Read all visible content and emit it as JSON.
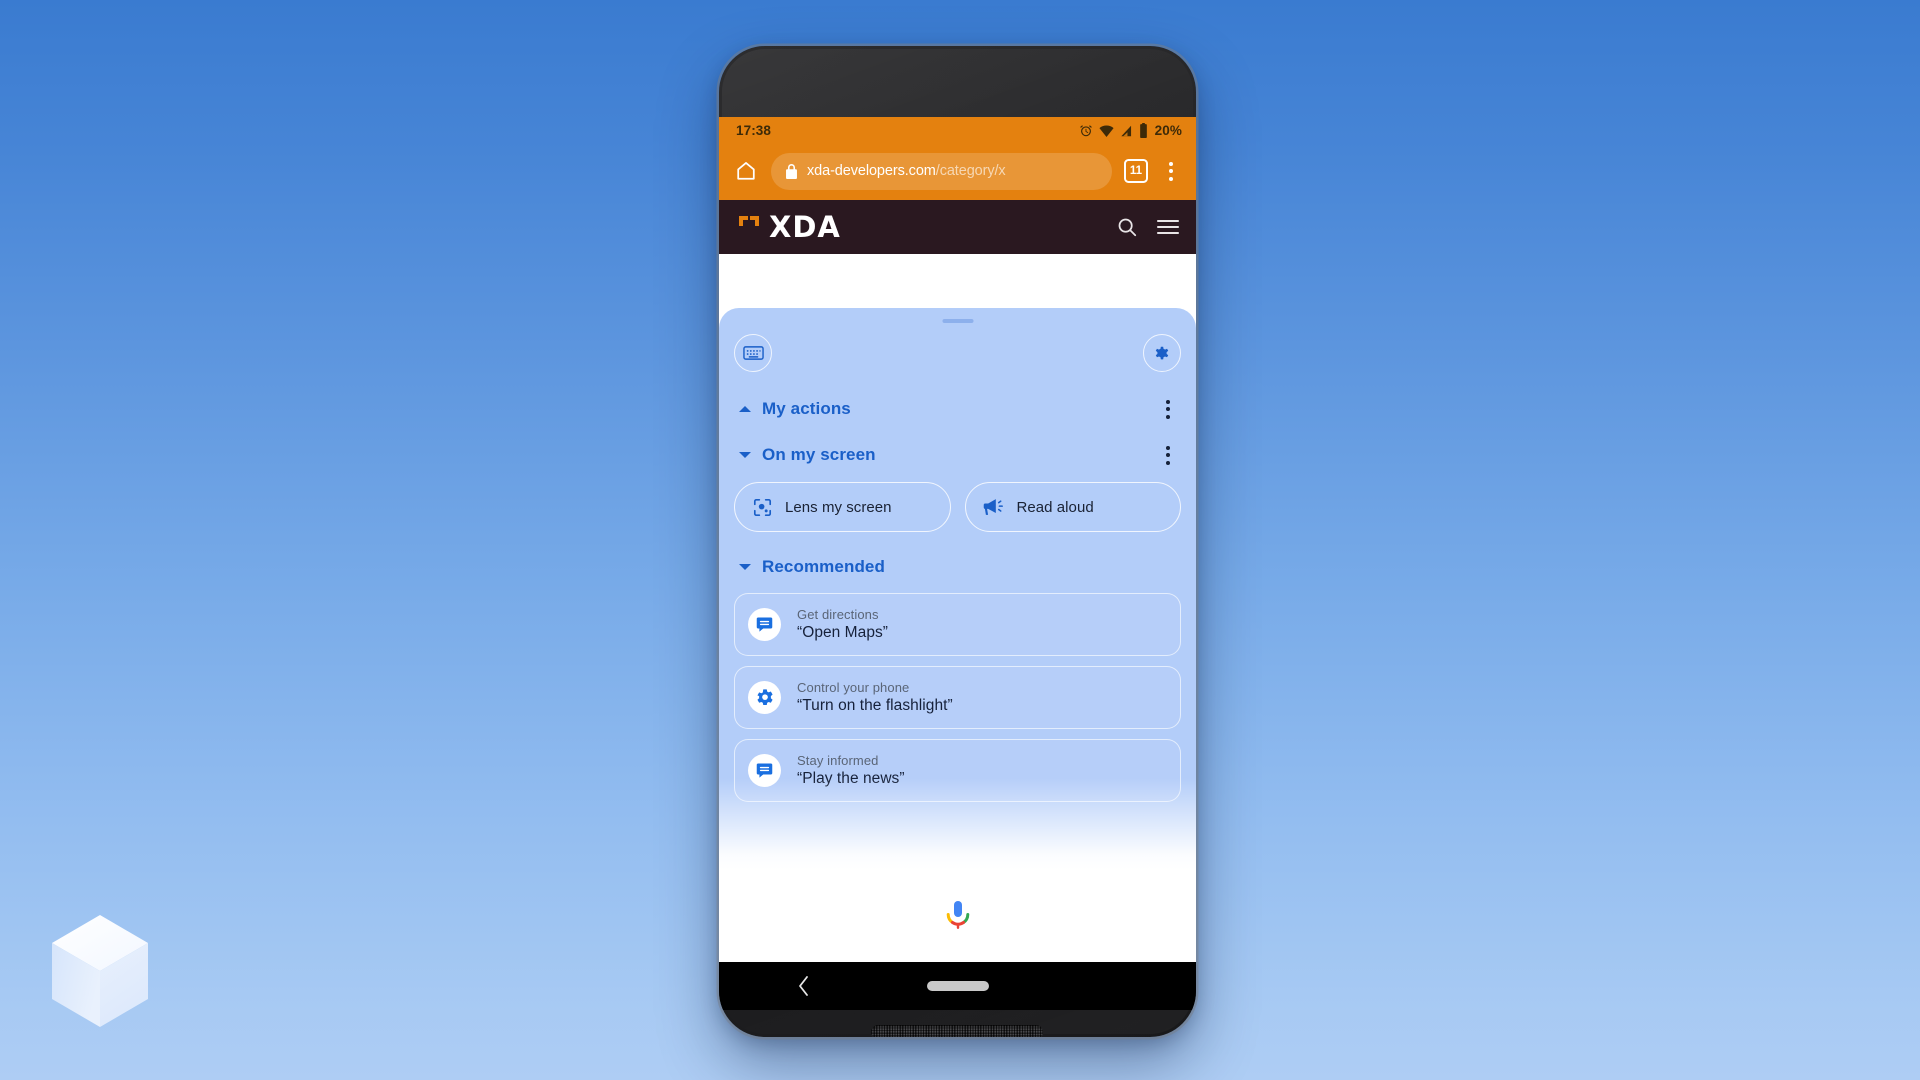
{
  "backdrop": {
    "gradient_top": "#3a7bd0",
    "gradient_bottom": "#aecdf4",
    "watermark_icon": "cube-logo"
  },
  "phone": {
    "front_camera_icon": "front-camera-icon",
    "earpiece_icon": "earpiece-speaker-icon",
    "bottom_speaker_icon": "bottom-speaker-icon"
  },
  "browser": {
    "status_bar": {
      "time": "17:38",
      "alarm_icon": "alarm-icon",
      "wifi_icon": "wifi-icon",
      "signal_icon": "cellular-signal-icon",
      "battery_icon": "battery-icon",
      "battery_percent": "20%",
      "background_color": "#e4810f"
    },
    "toolbar": {
      "home_icon": "home-icon",
      "lock_icon": "lock-icon",
      "url_domain": "xda-developers.com",
      "url_path": "/category/x",
      "tab_count": "11",
      "overflow_icon": "chrome-overflow-icon"
    },
    "site_header": {
      "wordmark": "XDA",
      "logo_icon": "xda-bracket-logo-icon",
      "search_icon": "search-icon",
      "menu_icon": "hamburger-menu-icon",
      "background_color": "#2a1820",
      "accent_color": "#e4810f"
    }
  },
  "assistant": {
    "panel_color": "#b3cdf9",
    "accent_color": "#1a5fc8",
    "drag_handle_icon": "drag-handle",
    "keyboard_button": {
      "icon": "keyboard-icon"
    },
    "settings_button": {
      "icon": "gear-icon"
    },
    "sections": [
      {
        "title": "My actions",
        "chevron": "chevron-up-icon",
        "menu_icon": "overflow-menu-icon"
      },
      {
        "title": "On my screen",
        "chevron": "chevron-down-icon",
        "menu_icon": "overflow-menu-icon"
      },
      {
        "title": "Recommended",
        "chevron": "chevron-down-icon"
      }
    ],
    "chips": [
      {
        "label": "Lens my screen",
        "icon": "google-lens-icon"
      },
      {
        "label": "Read aloud",
        "icon": "megaphone-icon"
      }
    ],
    "recommended": [
      {
        "title": "Get directions",
        "quote": "“Open Maps”",
        "icon": "chat-bubble-icon"
      },
      {
        "title": "Control your phone",
        "quote": "“Turn on the flashlight”",
        "icon": "gear-icon"
      },
      {
        "title": "Stay informed",
        "quote": "“Play the news”",
        "icon": "chat-bubble-icon"
      }
    ],
    "mic_button": {
      "icon": "google-mic-icon",
      "colors": [
        "#4285f4",
        "#ea4335",
        "#fbbc05",
        "#34a853"
      ]
    }
  },
  "nav_bar": {
    "back_icon": "back-chevron-icon",
    "home_pill_icon": "home-pill-icon"
  }
}
